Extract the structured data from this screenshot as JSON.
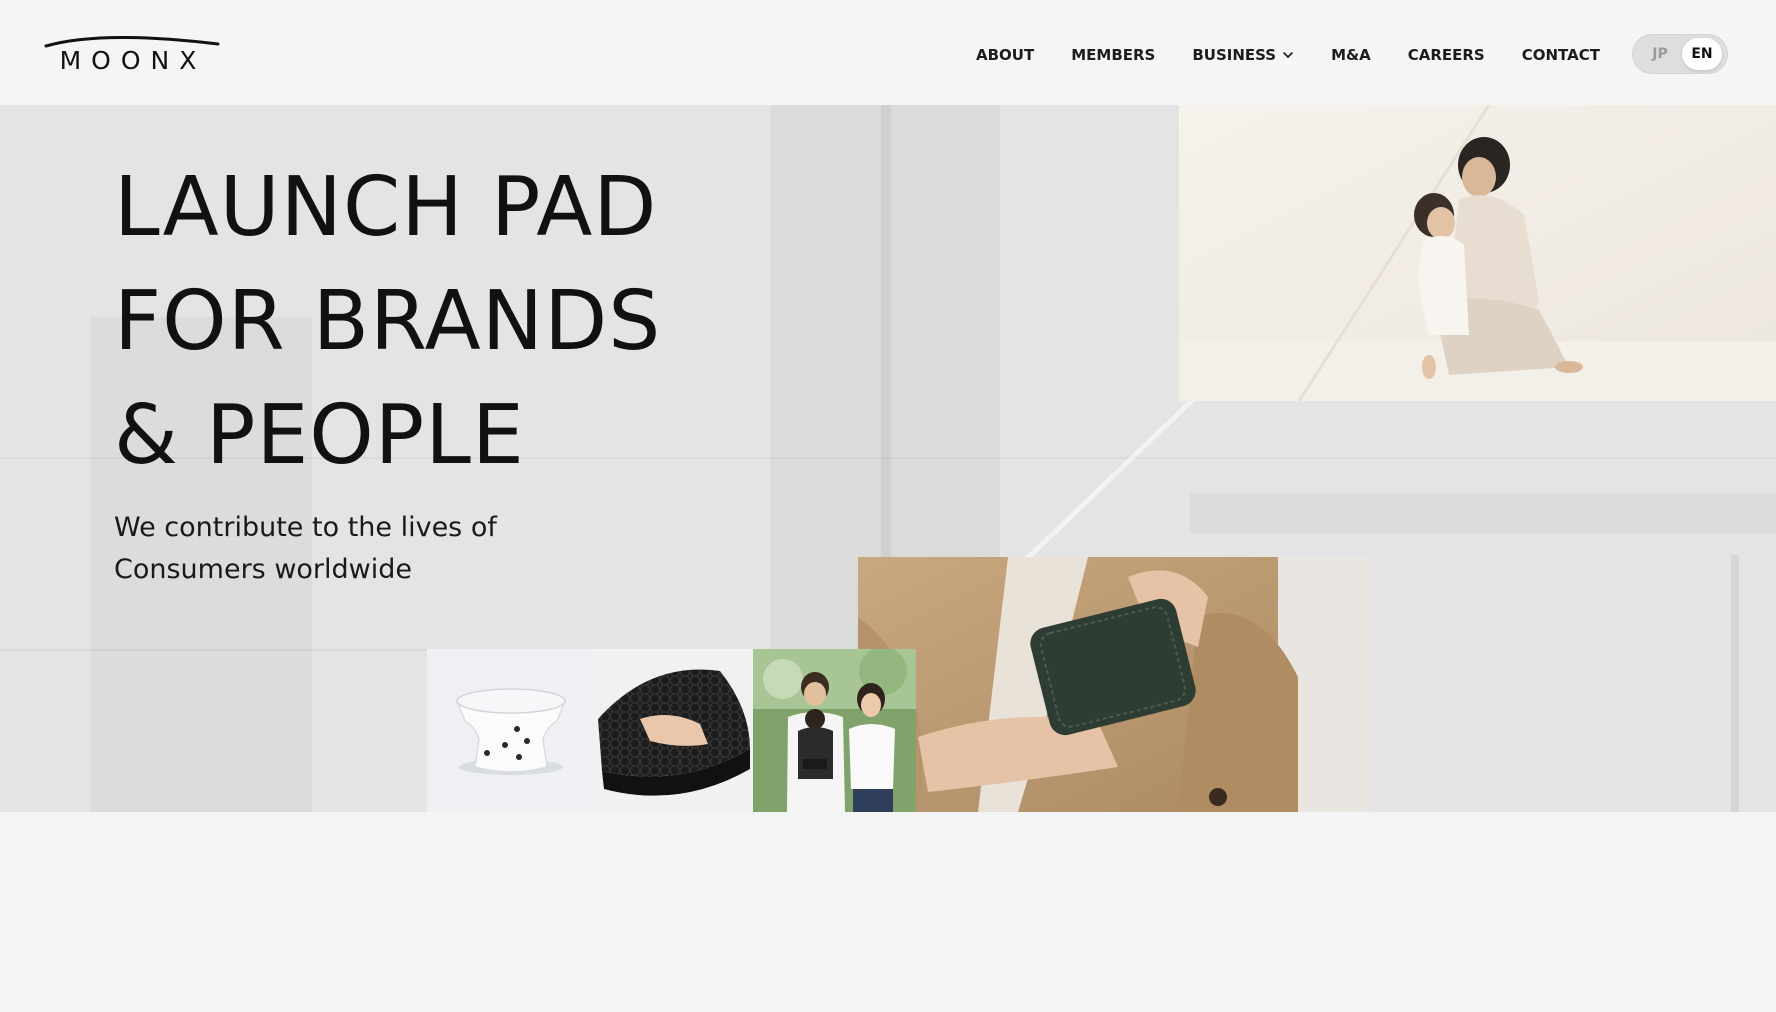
{
  "brand": {
    "logo_text": "MOONX"
  },
  "nav": {
    "items": [
      {
        "label": "ABOUT"
      },
      {
        "label": "MEMBERS"
      },
      {
        "label": "BUSINESS"
      },
      {
        "label": "M&A"
      },
      {
        "label": "CAREERS"
      },
      {
        "label": "CONTACT"
      }
    ]
  },
  "language": {
    "options": [
      "JP",
      "EN"
    ],
    "selected": "EN"
  },
  "hero": {
    "title_lines": [
      "LAUNCH PAD",
      "FOR BRANDS",
      "& PEOPLE"
    ],
    "subtitle_lines": [
      "We contribute to the lives of",
      "Consumers worldwide"
    ]
  },
  "theme": {
    "page_background": "#f3f3f3",
    "hero_background": "#e4e4e4",
    "text_color": "#111111",
    "toggle_active_background": "#ffffff",
    "toggle_track_background": "#dedede"
  },
  "icons": {
    "business_dropdown": "chevron-down-icon"
  }
}
